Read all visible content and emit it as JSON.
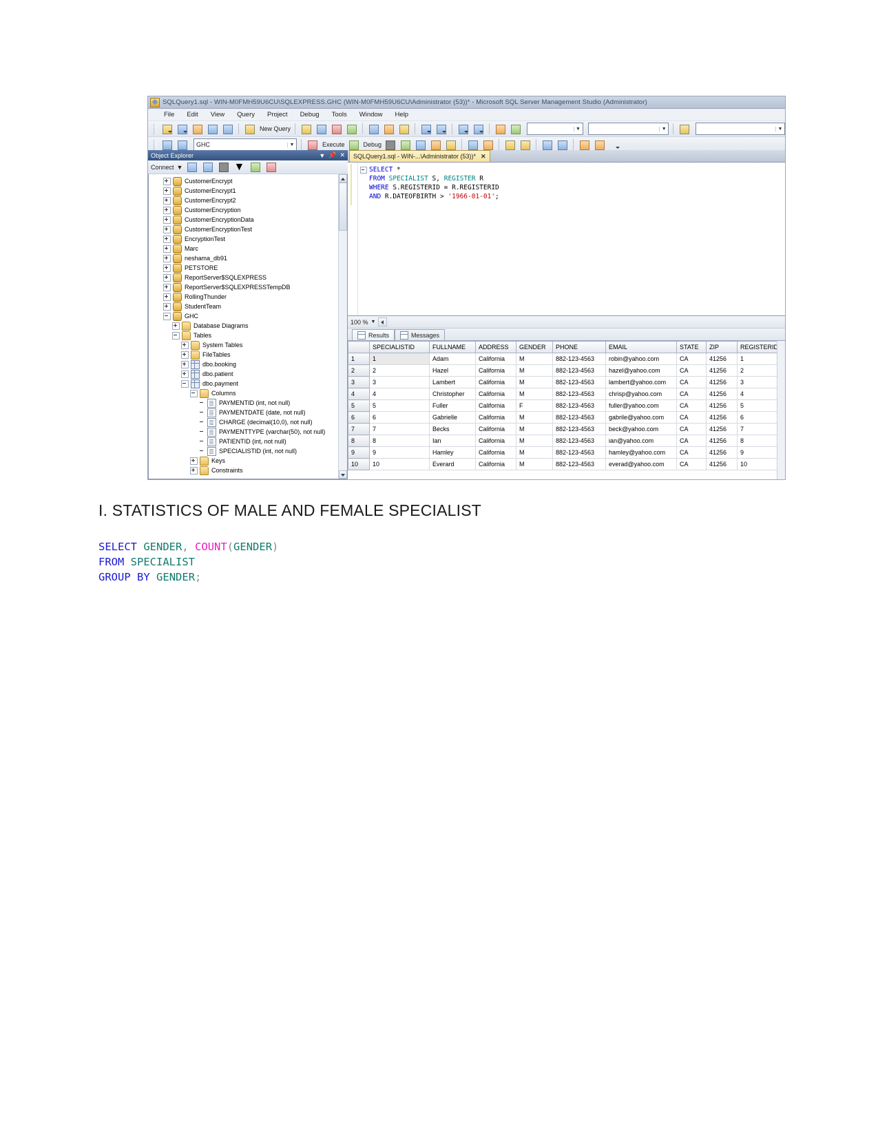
{
  "window": {
    "title": "SQLQuery1.sql - WIN-M0FMH59U6CU\\SQLEXPRESS.GHC (WIN-M0FMH59U6CU\\Administrator (53))* - Microsoft SQL Server Management Studio (Administrator)",
    "icon": "ssms-icon"
  },
  "menubar": [
    "File",
    "Edit",
    "View",
    "Query",
    "Project",
    "Debug",
    "Tools",
    "Window",
    "Help"
  ],
  "toolbar": {
    "new_query_label": "New Query",
    "database_combo": "GHC",
    "execute_label": "Execute",
    "debug_label": "Debug"
  },
  "object_explorer": {
    "title": "Object Explorer",
    "connect_label": "Connect",
    "tree": [
      {
        "label": "CustomerEncrypt",
        "indent": 1,
        "state": "plus",
        "icon": "database-icon"
      },
      {
        "label": "CustomerEncrypt1",
        "indent": 1,
        "state": "plus",
        "icon": "database-icon"
      },
      {
        "label": "CustomerEncrypt2",
        "indent": 1,
        "state": "plus",
        "icon": "database-icon"
      },
      {
        "label": "CustomerEncryption",
        "indent": 1,
        "state": "plus",
        "icon": "database-icon"
      },
      {
        "label": "CustomerEncryptionData",
        "indent": 1,
        "state": "plus",
        "icon": "database-icon"
      },
      {
        "label": "CustomerEncryptionTest",
        "indent": 1,
        "state": "plus",
        "icon": "database-icon"
      },
      {
        "label": "EncryptionTest",
        "indent": 1,
        "state": "plus",
        "icon": "database-icon"
      },
      {
        "label": "Marc",
        "indent": 1,
        "state": "plus",
        "icon": "database-icon"
      },
      {
        "label": "neshama_db91",
        "indent": 1,
        "state": "plus",
        "icon": "database-icon"
      },
      {
        "label": "PETSTORE",
        "indent": 1,
        "state": "plus",
        "icon": "database-icon"
      },
      {
        "label": "ReportServer$SQLEXPRESS",
        "indent": 1,
        "state": "plus",
        "icon": "database-icon"
      },
      {
        "label": "ReportServer$SQLEXPRESSTempDB",
        "indent": 1,
        "state": "plus",
        "icon": "database-icon"
      },
      {
        "label": "RollingThunder",
        "indent": 1,
        "state": "plus",
        "icon": "database-icon"
      },
      {
        "label": "StudentTeam",
        "indent": 1,
        "state": "plus",
        "icon": "database-icon"
      },
      {
        "label": "GHC",
        "indent": 1,
        "state": "minus",
        "icon": "database-icon"
      },
      {
        "label": "Database Diagrams",
        "indent": 2,
        "state": "plus",
        "icon": "folder-icon"
      },
      {
        "label": "Tables",
        "indent": 2,
        "state": "minus",
        "icon": "folder-icon"
      },
      {
        "label": "System Tables",
        "indent": 3,
        "state": "plus",
        "icon": "folder-icon"
      },
      {
        "label": "FileTables",
        "indent": 3,
        "state": "plus",
        "icon": "folder-icon"
      },
      {
        "label": "dbo.booking",
        "indent": 3,
        "state": "plus",
        "icon": "table-icon"
      },
      {
        "label": "dbo.patient",
        "indent": 3,
        "state": "plus",
        "icon": "table-icon"
      },
      {
        "label": "dbo.payment",
        "indent": 3,
        "state": "minus",
        "icon": "table-icon"
      },
      {
        "label": "Columns",
        "indent": 4,
        "state": "minus",
        "icon": "folder-icon"
      },
      {
        "label": "PAYMENTID (int, not null)",
        "indent": 5,
        "state": "none",
        "icon": "column-icon"
      },
      {
        "label": "PAYMENTDATE (date, not null)",
        "indent": 5,
        "state": "none",
        "icon": "column-icon"
      },
      {
        "label": "CHARGE (decimal(10,0), not null)",
        "indent": 5,
        "state": "none",
        "icon": "column-icon"
      },
      {
        "label": "PAYMENTTYPE (varchar(50), not null)",
        "indent": 5,
        "state": "none",
        "icon": "column-icon"
      },
      {
        "label": "PATIENTID (int, not null)",
        "indent": 5,
        "state": "none",
        "icon": "column-icon"
      },
      {
        "label": "SPECIALISTID (int, not null)",
        "indent": 5,
        "state": "none",
        "icon": "column-icon"
      },
      {
        "label": "Keys",
        "indent": 4,
        "state": "plus",
        "icon": "folder-icon"
      },
      {
        "label": "Constraints",
        "indent": 4,
        "state": "plus",
        "icon": "folder-icon"
      }
    ]
  },
  "editor": {
    "tab_label": "SQLQuery1.sql - WIN-...\\Administrator (53))*",
    "tab_close": "✕",
    "zoom": "100 %",
    "lines": [
      [
        {
          "t": "SELECT",
          "c": "k-blue"
        },
        {
          "t": " *",
          "c": "k-black"
        }
      ],
      [
        {
          "t": "FROM",
          "c": "k-blue"
        },
        {
          "t": " ",
          "c": "k-black"
        },
        {
          "t": "SPECIALIST",
          "c": "k-teal"
        },
        {
          "t": " S, ",
          "c": "k-black"
        },
        {
          "t": "REGISTER",
          "c": "k-teal"
        },
        {
          "t": " R",
          "c": "k-black"
        }
      ],
      [
        {
          "t": "WHERE",
          "c": "k-blue"
        },
        {
          "t": " S.REGISTERID = R.REGISTERID",
          "c": "k-black"
        }
      ],
      [
        {
          "t": "AND",
          "c": "k-blue"
        },
        {
          "t": " R.DATEOFBIRTH > ",
          "c": "k-black"
        },
        {
          "t": "'1966-01-01'",
          "c": "k-red"
        },
        {
          "t": ";",
          "c": "k-black"
        }
      ]
    ]
  },
  "results": {
    "tabs": [
      {
        "label": "Results",
        "icon": "grid-icon",
        "active": true
      },
      {
        "label": "Messages",
        "icon": "message-icon",
        "active": false
      }
    ],
    "columns": [
      "SPECIALISTID",
      "FULLNAME",
      "ADDRESS",
      "GENDER",
      "PHONE",
      "EMAIL",
      "STATE",
      "ZIP",
      "REGISTERID"
    ],
    "rows": [
      {
        "n": "1",
        "cells": [
          "1",
          "Adam",
          "California",
          "M",
          "882-123-4563",
          "robin@yahoo.com",
          "CA",
          "41256",
          "1"
        ]
      },
      {
        "n": "2",
        "cells": [
          "2",
          "Hazel",
          "California",
          "M",
          "882-123-4563",
          "hazel@yahoo.com",
          "CA",
          "41256",
          "2"
        ]
      },
      {
        "n": "3",
        "cells": [
          "3",
          "Lambert",
          "California",
          "M",
          "882-123-4563",
          "lambert@yahoo.com",
          "CA",
          "41256",
          "3"
        ]
      },
      {
        "n": "4",
        "cells": [
          "4",
          "Christopher",
          "California",
          "M",
          "882-123-4563",
          "chrisp@yahoo.com",
          "CA",
          "41256",
          "4"
        ]
      },
      {
        "n": "5",
        "cells": [
          "5",
          "Fuller",
          "California",
          "F",
          "882-123-4563",
          "fuller@yahoo.com",
          "CA",
          "41256",
          "5"
        ]
      },
      {
        "n": "6",
        "cells": [
          "6",
          "Gabrielle",
          "California",
          "M",
          "882-123-4563",
          "gabrile@yahoo.com",
          "CA",
          "41256",
          "6"
        ]
      },
      {
        "n": "7",
        "cells": [
          "7",
          "Becks",
          "California",
          "M",
          "882-123-4563",
          "beck@yahoo.com",
          "CA",
          "41256",
          "7"
        ]
      },
      {
        "n": "8",
        "cells": [
          "8",
          "Ian",
          "California",
          "M",
          "882-123-4563",
          "ian@yahoo.com",
          "CA",
          "41256",
          "8"
        ]
      },
      {
        "n": "9",
        "cells": [
          "9",
          "Hamley",
          "California",
          "M",
          "882-123-4563",
          "hamley@yahoo.com",
          "CA",
          "41256",
          "9"
        ]
      },
      {
        "n": "10",
        "cells": [
          "10",
          "Everard",
          "California",
          "M",
          "882-123-4563",
          "everad@yahoo.com",
          "CA",
          "41256",
          "10"
        ]
      }
    ]
  },
  "document": {
    "heading": "I. STATISTICS OF MALE AND FEMALE SPECIALIST",
    "code_lines": [
      [
        {
          "t": "SELECT",
          "c": "c-blue"
        },
        {
          "t": " ",
          "c": "c-grey"
        },
        {
          "t": "GENDER",
          "c": "c-teal"
        },
        {
          "t": ",",
          "c": "c-grey"
        },
        {
          "t": " ",
          "c": "c-grey"
        },
        {
          "t": "COUNT",
          "c": "c-mag"
        },
        {
          "t": "(",
          "c": "c-grey"
        },
        {
          "t": "GENDER",
          "c": "c-teal"
        },
        {
          "t": ")",
          "c": "c-grey"
        }
      ],
      [
        {
          "t": "FROM",
          "c": "c-blue"
        },
        {
          "t": " ",
          "c": "c-grey"
        },
        {
          "t": "SPECIALIST",
          "c": "c-teal"
        }
      ],
      [
        {
          "t": "GROUP",
          "c": "c-blue"
        },
        {
          "t": " ",
          "c": "c-grey"
        },
        {
          "t": "BY",
          "c": "c-blue"
        },
        {
          "t": " ",
          "c": "c-grey"
        },
        {
          "t": "GENDER",
          "c": "c-teal"
        },
        {
          "t": ";",
          "c": "c-grey"
        }
      ]
    ]
  },
  "colors": {
    "title_bar": "#b7c2d4",
    "oe_header": "#32527f",
    "tab_active": "#f6e39a",
    "sql_keyword": "#0000d0",
    "sql_string": "#c00000",
    "doc_keyword": "#1a1ad0",
    "doc_identifier": "#0f7b6c",
    "doc_function": "#e81fc1"
  }
}
